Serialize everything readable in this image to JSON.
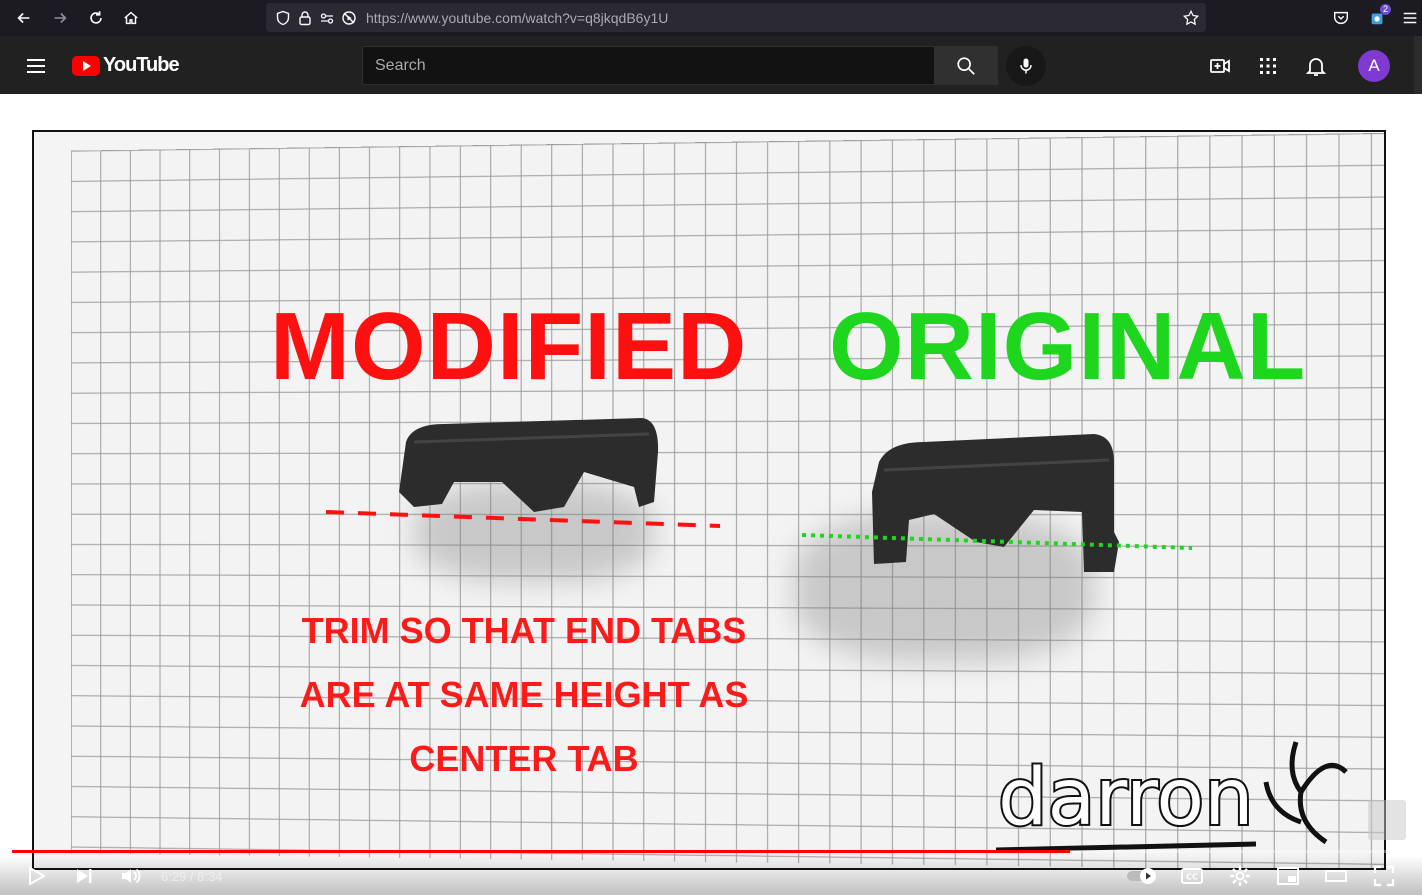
{
  "browser": {
    "url_host": "https://www.youtube.com",
    "url_path": "/watch?v=q8jkqdB6y1U",
    "extension_badge": "2"
  },
  "header": {
    "logo_text": "YouTube",
    "search_placeholder": "Search",
    "avatar_initial": "A"
  },
  "video": {
    "overlay_modified": "MODIFIED",
    "overlay_original": "ORIGINAL",
    "instruction_lines": [
      "TRIM SO THAT END TABS",
      "ARE AT SAME HEIGHT AS",
      "CENTER TAB"
    ],
    "watermark_text": "darron",
    "colors": {
      "modified": "#ff1010",
      "original": "#1ed61e"
    }
  },
  "player": {
    "current_time": "6:29",
    "duration": "8:34",
    "time_display": "6:29 / 8:34",
    "progress_fraction": 0.757
  }
}
